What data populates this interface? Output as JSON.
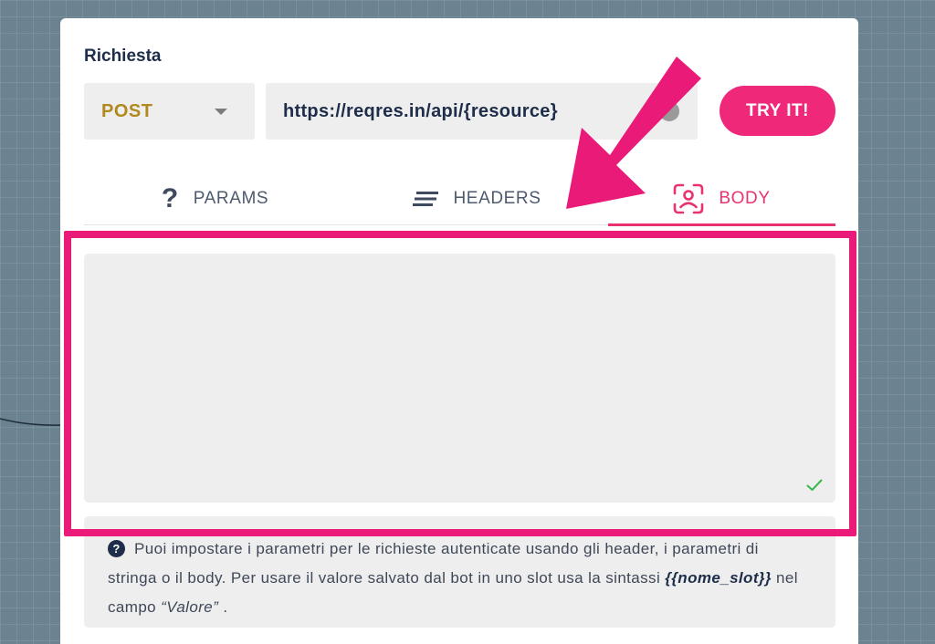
{
  "request": {
    "section_title": "Richiesta",
    "method": "POST",
    "url": "https://reqres.in/api/{resource}",
    "try_button": "TRY IT!"
  },
  "tabs": [
    {
      "label": "PARAMS",
      "icon": "question-mark-icon"
    },
    {
      "label": "HEADERS",
      "icon": "lines-icon"
    },
    {
      "label": "BODY",
      "icon": "user-body-icon",
      "active": true
    }
  ],
  "body_editor": {
    "value": "",
    "status_icon": "check-icon"
  },
  "help": {
    "icon": "question-circle-icon",
    "text_1": "Puoi impostare i parametri per le richieste autenticate usando gli header, i parametri di stringa o il body. Per usare il valore salvato dal bot in uno slot usa la sintassi ",
    "slot_syntax": "{{nome_slot}}",
    "text_2": " nel campo ",
    "field_name": "“Valore”",
    "text_3": " ."
  },
  "colors": {
    "accent": "#f0287a",
    "annotation": "#ea1a78",
    "method": "#b08a1e",
    "text_dark": "#1e2d4a",
    "valid": "#35b84a"
  }
}
